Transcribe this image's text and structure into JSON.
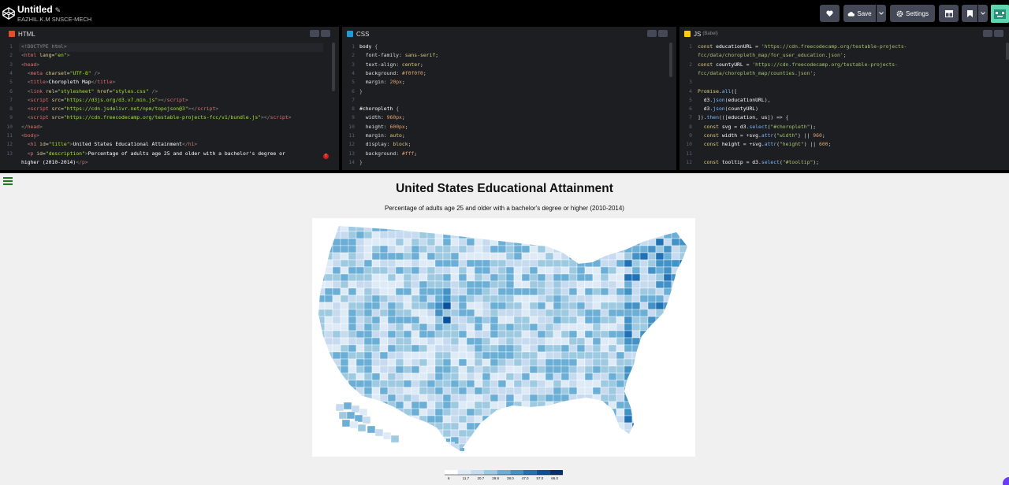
{
  "header": {
    "title": "Untitled",
    "owner": "EAZHIL.K.M SNSCE-MECH",
    "buttons": {
      "save": "Save",
      "settings": "Settings"
    }
  },
  "panes": {
    "html": {
      "label": "HTML"
    },
    "css": {
      "label": "CSS"
    },
    "js": {
      "label": "JS",
      "sublabel": "(Babel)"
    }
  },
  "preview": {
    "title": "United States Educational Attainment",
    "description": "Percentage of adults age 25 and older with a bachelor's degree or higher (2010-2014)",
    "legend_ticks": [
      "6",
      "11.7",
      "20.7",
      "29.8",
      "38.0",
      "47.0",
      "57.0",
      "66.0"
    ]
  },
  "colors": {
    "accent_green": "#1b7b1b",
    "legend_scale": [
      "#ffffff",
      "#deebf7",
      "#c6dbef",
      "#9ecae1",
      "#6baed6",
      "#4292c6",
      "#2171b5",
      "#08519c",
      "#08306b"
    ],
    "fab": "#6c3cf5"
  },
  "icons": {
    "logo": "codepen-logo-icon",
    "heart": "heart-icon",
    "cloud": "cloud-icon",
    "gear": "gear-icon",
    "layout": "layout-icon",
    "bookmark": "bookmark-icon",
    "chevron": "chevron-down-icon",
    "menu": "hamburger-menu-icon",
    "error": "error-badge-icon"
  }
}
